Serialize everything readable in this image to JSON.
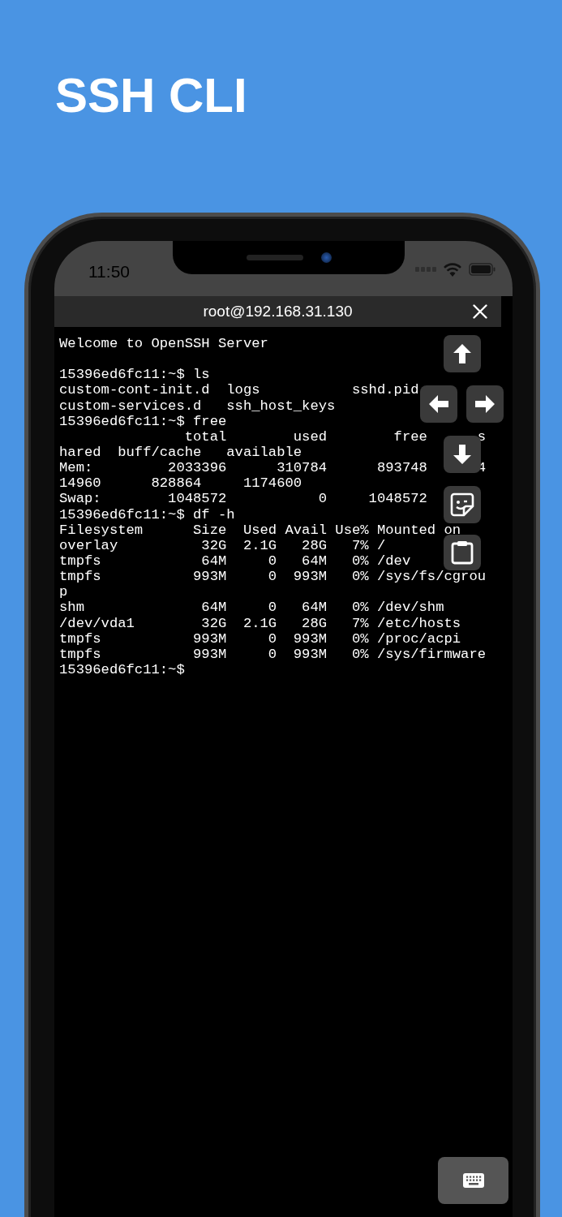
{
  "headline": "SSH CLI",
  "status_bar": {
    "time": "11:50"
  },
  "session": {
    "title": "root@192.168.31.130"
  },
  "terminal": {
    "banner": "Welcome to OpenSSH Server",
    "lines": [
      "15396ed6fc11:~$ ls",
      "custom-cont-init.d  logs           sshd.pid",
      "custom-services.d   ssh_host_keys",
      "15396ed6fc11:~$ free",
      "               total        used        free      s",
      "hared  buff/cache   available",
      "Mem:         2033396      310784      893748      4",
      "14960      828864     1174600",
      "Swap:        1048572           0     1048572",
      "15396ed6fc11:~$ df -h",
      "Filesystem      Size  Used Avail Use% Mounted on",
      "overlay          32G  2.1G   28G   7% /",
      "tmpfs            64M     0   64M   0% /dev",
      "tmpfs           993M     0  993M   0% /sys/fs/cgrou",
      "p",
      "shm              64M     0   64M   0% /dev/shm",
      "/dev/vda1        32G  2.1G   28G   7% /etc/hosts",
      "tmpfs           993M     0  993M   0% /proc/acpi",
      "tmpfs           993M     0  993M   0% /sys/firmware",
      "15396ed6fc11:~$"
    ]
  }
}
